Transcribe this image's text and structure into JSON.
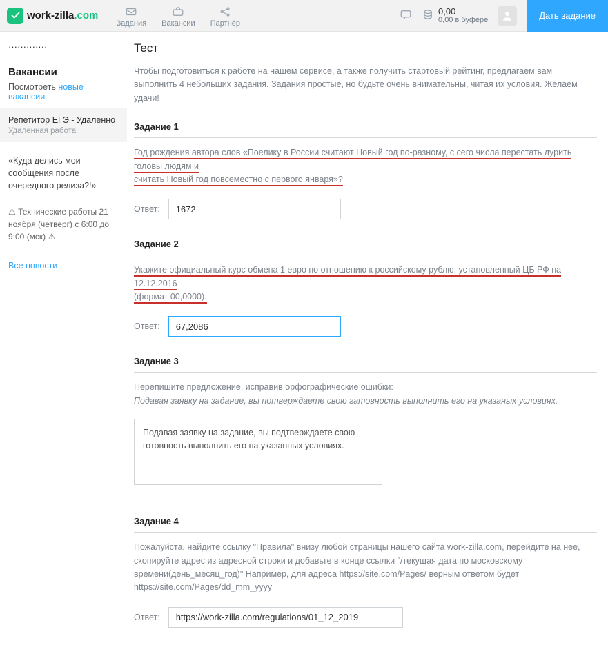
{
  "header": {
    "logo_main": "work-zilla",
    "logo_suffix": ".com",
    "nav": [
      {
        "label": "Задания"
      },
      {
        "label": "Вакансии"
      },
      {
        "label": "Партнёр"
      }
    ],
    "balance_amount": "0,00",
    "balance_sub": "0,00 в буфере",
    "cta": "Дать задание"
  },
  "sidebar": {
    "vacancies_title": "Вакансии",
    "view_prefix": "Посмотреть",
    "view_link": "новые вакансии",
    "featured_title": "Репетитор ЕГЭ - Удаленно",
    "featured_sub": "Удаленная работа",
    "quote": "«Куда делись мои сообщения после очередного релиза?!»",
    "maintenance": "⚠ Технические работы 21 ноября (четверг) с 6:00 до 9:00 (мск) ⚠",
    "all_news": "Все новости"
  },
  "content": {
    "title": "Тест",
    "intro": "Чтобы подготовиться к работе на нашем сервисе, а также получить стартовый рейтинг, предлагаем вам выполнить 4 небольших задания. Задания простые, но будьте очень внимательны, читая их условия. Желаем удачи!",
    "answer_label": "Ответ:",
    "task1": {
      "title": "Задание 1",
      "text_line1": "Год рождения автора слов «Поелику в России считают Новый год по-разному, с сего числа перестать дурить головы людям и",
      "text_line2": "считать Новый год повсеместно с первого января»?",
      "answer": "1672"
    },
    "task2": {
      "title": "Задание 2",
      "text_line1": "Укажите официальный курс обмена 1 евро по отношению к российскому рублю, установленный ЦБ РФ на 12.12.2016",
      "text_line2": "(формат 00,0000).",
      "answer": "67,2086"
    },
    "task3": {
      "title": "Задание 3",
      "prompt": "Перепишите предложение, исправив орфографические ошибки:",
      "sample": "Подавая заявку на задание, вы потверждаете свою гатовность выполнить его на указаных условиях.",
      "answer": "Подавая заявку на задание, вы подтверждаете свою готовность выполнить его на указанных условиях."
    },
    "task4": {
      "title": "Задание 4",
      "text": "Пожалуйста, найдите ссылку \"Правила\" внизу любой страницы нашего сайта work-zilla.com, перейдите на нее, скопируйте адрес из адресной строки и добавьте в конце ссылки \"/текущая дата по московскому времени(день_месяц_год)\" Например, для адреса https://site.com/Pages/ верным ответом будет https://site.com/Pages/dd_mm_yyyy",
      "answer": "https://work-zilla.com/regulations/01_12_2019"
    }
  }
}
